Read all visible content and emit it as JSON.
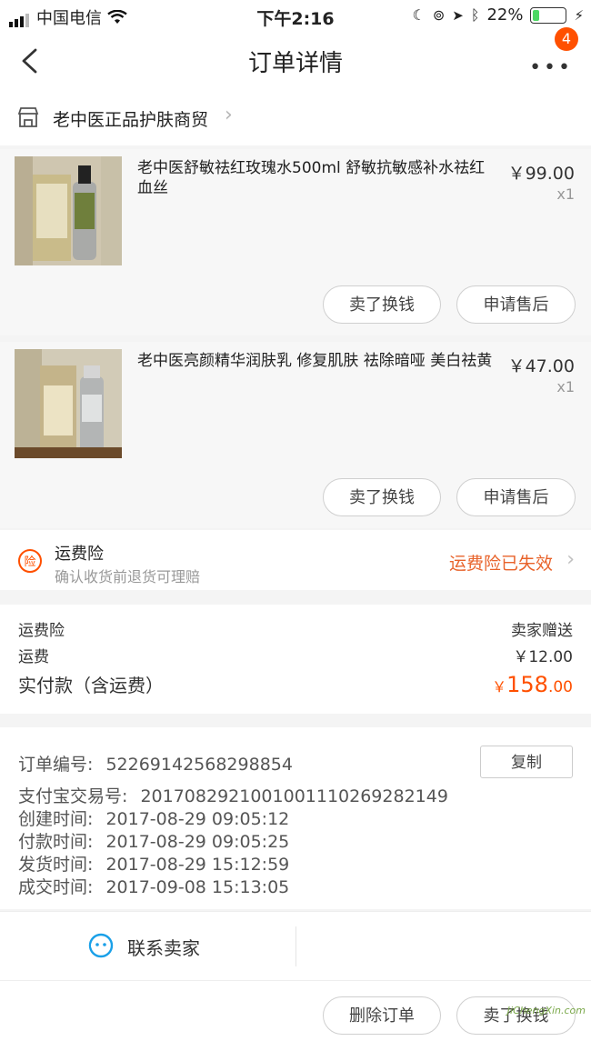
{
  "status_bar": {
    "carrier": "中国电信",
    "time": "下午2:16",
    "battery": "22%",
    "battery_level": 0.22
  },
  "nav": {
    "title": "订单详情",
    "badge": "4"
  },
  "shop": {
    "name": "老中医正品护肤商贸"
  },
  "products": [
    {
      "title": "老中医舒敏祛红玫瑰水500ml 舒敏抗敏感补水祛红血丝",
      "price": "￥99.00",
      "qty": "x1",
      "buttons": [
        "卖了换钱",
        "申请售后"
      ]
    },
    {
      "title": "老中医亮颜精华润肤乳 修复肌肤 祛除暗哑 美白祛黄",
      "price": "￥47.00",
      "qty": "x1",
      "buttons": [
        "卖了换钱",
        "申请售后"
      ]
    }
  ],
  "insurance": {
    "icon_text": "险",
    "title": "运费险",
    "subtitle": "确认收货前退货可理赔",
    "status": "运费险已失效"
  },
  "fees": {
    "insurance_label": "运费险",
    "insurance_value": "卖家赠送",
    "shipping_label": "运费",
    "shipping_value": "￥12.00",
    "total_label": "实付款（含运费）",
    "total_currency": "￥",
    "total_int": "158",
    "total_dec": ".00"
  },
  "order_info": {
    "order_no_label": "订单编号:",
    "order_no": "52269142568298854",
    "copy_label": "复制",
    "alipay_label": "支付宝交易号:",
    "alipay_no": "2017082921001001110269282149",
    "created_label": "创建时间:",
    "created": "2017-08-29 09:05:12",
    "paid_label": "付款时间:",
    "paid": "2017-08-29 09:05:25",
    "shipped_label": "发货时间:",
    "shipped": "2017-08-29 15:12:59",
    "closed_label": "成交时间:",
    "closed": "2017-09-08 15:13:05"
  },
  "contact": {
    "label": "联系卖家"
  },
  "bottom": {
    "delete_label": "删除订单",
    "sell_label": "卖了换钱"
  },
  "watermark": "JiChengXin.com",
  "colors": {
    "accent": "#ff5000",
    "insurance_status": "#e8632b",
    "total": "#ff5000"
  }
}
